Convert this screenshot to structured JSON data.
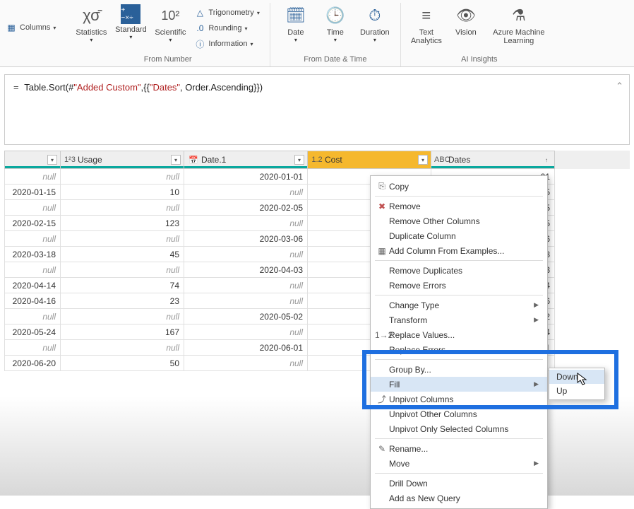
{
  "ribbon": {
    "columns_label": "Columns",
    "from_number": {
      "statistics": "Statistics",
      "standard": "Standard",
      "scientific": "Scientific",
      "trig": "Trigonometry",
      "rounding": "Rounding",
      "information": "Information",
      "group_label": "From Number"
    },
    "from_datetime": {
      "date": "Date",
      "time": "Time",
      "duration": "Duration",
      "group_label": "From Date & Time"
    },
    "ai": {
      "text": "Text\nAnalytics",
      "vision": "Vision",
      "aml": "Azure Machine\nLearning",
      "group_label": "AI Insights"
    }
  },
  "formula": {
    "prefix": "= ",
    "part1": "Table.Sort(#",
    "str1": "\"Added Custom\"",
    "part2": ",{{",
    "str2": "\"Dates\"",
    "part3": ", Order.Ascending}})"
  },
  "columns": {
    "c0": "",
    "c1": "Usage",
    "c2": "Date.1",
    "c3": "Cost",
    "c4": "Dates",
    "type1": "1²3",
    "type2": "📅",
    "type3": "1.2",
    "type4": "ABC"
  },
  "rows": [
    {
      "c0": "null",
      "c1": "null",
      "c2": "2020-01-01",
      "c3": "",
      "c4": "01"
    },
    {
      "c0": "2020-01-15",
      "c1": "10",
      "c2": "null",
      "c3": "",
      "c4": "5"
    },
    {
      "c0": "null",
      "c1": "null",
      "c2": "2020-02-05",
      "c3": "",
      "c4": "5"
    },
    {
      "c0": "2020-02-15",
      "c1": "123",
      "c2": "null",
      "c3": "",
      "c4": "5"
    },
    {
      "c0": "null",
      "c1": "null",
      "c2": "2020-03-06",
      "c3": "",
      "c4": "06"
    },
    {
      "c0": "2020-03-18",
      "c1": "45",
      "c2": "null",
      "c3": "",
      "c4": "8"
    },
    {
      "c0": "null",
      "c1": "null",
      "c2": "2020-04-03",
      "c3": "",
      "c4": "03"
    },
    {
      "c0": "2020-04-14",
      "c1": "74",
      "c2": "null",
      "c3": "",
      "c4": "4"
    },
    {
      "c0": "2020-04-16",
      "c1": "23",
      "c2": "null",
      "c3": "",
      "c4": "6"
    },
    {
      "c0": "null",
      "c1": "null",
      "c2": "2020-05-02",
      "c3": "",
      "c4": "2"
    },
    {
      "c0": "2020-05-24",
      "c1": "167",
      "c2": "null",
      "c3": "",
      "c4": "4"
    },
    {
      "c0": "null",
      "c1": "null",
      "c2": "2020-06-01",
      "c3": "",
      "c4": "1"
    },
    {
      "c0": "2020-06-20",
      "c1": "50",
      "c2": "null",
      "c3": "",
      "c4": ""
    }
  ],
  "ctx": {
    "copy": "Copy",
    "remove": "Remove",
    "remove_other": "Remove Other Columns",
    "duplicate": "Duplicate Column",
    "add_examples": "Add Column From Examples...",
    "remove_dup": "Remove Duplicates",
    "remove_err": "Remove Errors",
    "change_type": "Change Type",
    "transform": "Transform",
    "replace_values": "Replace Values...",
    "replace_errors": "Replace Errors...",
    "group_by": "Group By...",
    "fill": "Fill",
    "unpivot": "Unpivot Columns",
    "unpivot_other": "Unpivot Other Columns",
    "unpivot_sel": "Unpivot Only Selected Columns",
    "rename": "Rename...",
    "move": "Move",
    "drill": "Drill Down",
    "add_query": "Add as New Query"
  },
  "submenu": {
    "down": "Down",
    "up": "Up"
  }
}
